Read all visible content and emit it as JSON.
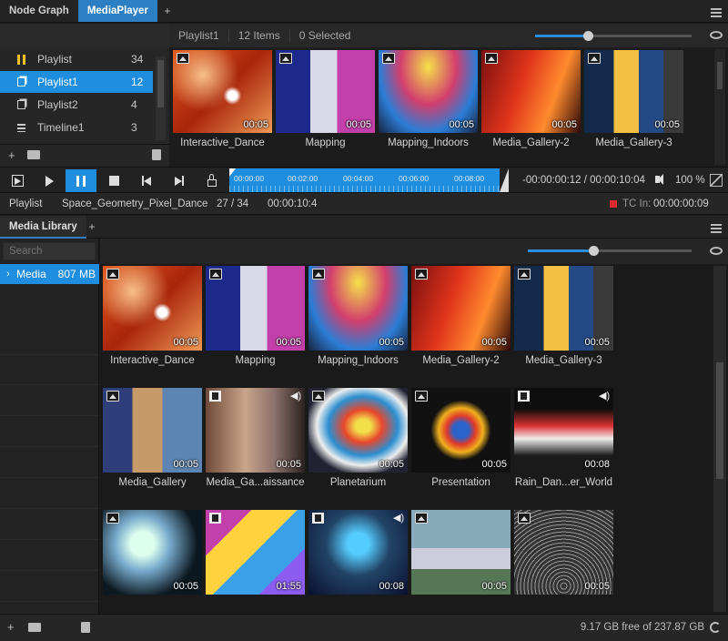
{
  "top_tabs": [
    "Node Graph",
    "MediaPlayer"
  ],
  "playlists": [
    {
      "label": "Playlist",
      "count": "34",
      "icon": "pause-icon"
    },
    {
      "label": "Playlist1",
      "count": "12",
      "icon": "playlist-icon",
      "selected": true
    },
    {
      "label": "Playlist2",
      "count": "4",
      "icon": "playlist-icon"
    },
    {
      "label": "Timeline1",
      "count": "3",
      "icon": "timeline-icon"
    }
  ],
  "strip": {
    "name": "Playlist1",
    "items": "12 Items",
    "selected": "0 Selected",
    "zoom_level": 0.34
  },
  "strip_items": [
    {
      "label": "Interactive_Dance",
      "dur": "00:05"
    },
    {
      "label": "Mapping",
      "dur": "00:05"
    },
    {
      "label": "Mapping_Indoors",
      "dur": "00:05"
    },
    {
      "label": "Media_Gallery-2",
      "dur": "00:05"
    },
    {
      "label": "Media_Gallery-3",
      "dur": "00:05"
    }
  ],
  "transport": {
    "ticks": [
      "00:00:00",
      "00:02:00",
      "00:04:00",
      "00:06:00",
      "00:08:00"
    ],
    "timecode": "-00:00:00:12 / 00:00:10:04",
    "volume": "100 %"
  },
  "status": {
    "mode": "Playlist",
    "clip": "Space_Geometry_Pixel_Dance",
    "position": "27 / 34",
    "duration": "00:00:10:4",
    "tc_label": "TC In:",
    "tc_value": "00:00:00:09"
  },
  "library": {
    "tab": "Media Library",
    "search_placeholder": "Search",
    "root": "Media",
    "root_size": "807 MB",
    "zoom_level": 0.4,
    "free_space": "9.17 GB free of 237.87 GB"
  },
  "library_items": [
    {
      "label": "Interactive_Dance",
      "dur": "00:05",
      "type": "image"
    },
    {
      "label": "Mapping",
      "dur": "00:05",
      "type": "image"
    },
    {
      "label": "Mapping_Indoors",
      "dur": "00:05",
      "type": "image"
    },
    {
      "label": "Media_Gallery-2",
      "dur": "00:05",
      "type": "image"
    },
    {
      "label": "Media_Gallery-3",
      "dur": "00:05",
      "type": "image"
    },
    {
      "label": "Media_Gallery",
      "dur": "00:05",
      "type": "image"
    },
    {
      "label": "Media_Ga...aissance",
      "dur": "00:05",
      "type": "video",
      "sound": true
    },
    {
      "label": "Planetarium",
      "dur": "00:05",
      "type": "image"
    },
    {
      "label": "Presentation",
      "dur": "00:05",
      "type": "image"
    },
    {
      "label": "Rain_Dan...er_World",
      "dur": "00:08",
      "type": "video",
      "sound": true
    },
    {
      "label": "",
      "dur": "00:05",
      "type": "image"
    },
    {
      "label": "",
      "dur": "01:55",
      "type": "video"
    },
    {
      "label": "",
      "dur": "00:08",
      "type": "video",
      "sound": true
    },
    {
      "label": "",
      "dur": "00:05",
      "type": "image"
    },
    {
      "label": "",
      "dur": "00:05",
      "type": "image"
    }
  ]
}
